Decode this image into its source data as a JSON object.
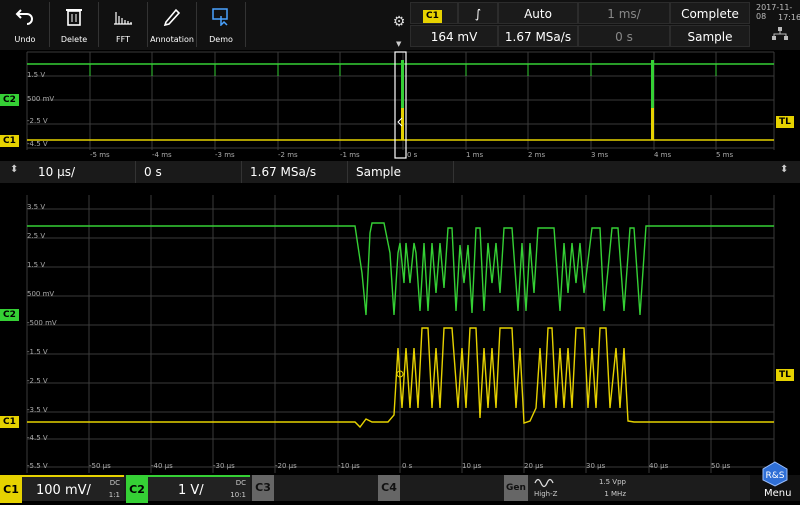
{
  "toolbar": {
    "buttons": [
      {
        "label": "Undo",
        "icon": "undo-icon"
      },
      {
        "label": "Delete",
        "icon": "trash-icon"
      },
      {
        "label": "FFT",
        "icon": "fft-icon"
      },
      {
        "label": "Annotation",
        "icon": "pen-icon"
      },
      {
        "label": "Demo",
        "icon": "demo-icon"
      }
    ],
    "trigger_source": "C1",
    "trigger_slope": "∫",
    "trigger_mode": "Auto",
    "timebase_top": "1 ms/",
    "acq_status": "Complete",
    "trigger_level": "164 mV",
    "sample_rate_top": "1.67 MSa/s",
    "position_top": "0 s",
    "acq_mode_top": "Sample",
    "date": "2017-11-08",
    "time": "17:16"
  },
  "overview": {
    "ylabels": [
      "1.5 V",
      "500 mV",
      "-2.5 V",
      "-4.5 V"
    ],
    "xlabels": [
      "-5 ms",
      "-4 ms",
      "-3 ms",
      "-2 ms",
      "-1 ms",
      "0 s",
      "1 ms",
      "2 ms",
      "3 ms",
      "4 ms",
      "5 ms"
    ],
    "markers": {
      "c2": "C2",
      "c1": "C1",
      "tl": "TL"
    }
  },
  "zoom_bar": {
    "timebase": "10 µs/",
    "position": "0 s",
    "sample_rate": "1.67 MSa/s",
    "acq_mode": "Sample"
  },
  "main": {
    "ylabels": [
      "3.5 V",
      "2.5 V",
      "1.5 V",
      "500 mV",
      "-500 mV",
      "-1.5 V",
      "-2.5 V",
      "-3.5 V",
      "-4.5 V",
      "-5.5 V"
    ],
    "xlabels": [
      "-50 µs",
      "-40 µs",
      "-30 µs",
      "-20 µs",
      "-10 µs",
      "0 s",
      "10 µs",
      "20 µs",
      "30 µs",
      "40 µs",
      "50 µs"
    ],
    "markers": {
      "c2": "C2",
      "c1": "C1",
      "tl": "TL"
    }
  },
  "channels": {
    "c1": {
      "tag": "C1",
      "scale": "100 mV/",
      "coupling": "DC",
      "probe": "1:1"
    },
    "c2": {
      "tag": "C2",
      "scale": "1 V/",
      "coupling": "DC",
      "probe": "10:1"
    },
    "c3": {
      "tag": "C3"
    },
    "c4": {
      "tag": "C4"
    },
    "gen": {
      "label": "Gen",
      "mode": "High-Z",
      "amplitude": "1.5 Vpp",
      "frequency": "1 MHz"
    },
    "menu": "Menu"
  },
  "colors": {
    "c1": "#e6d200",
    "c2": "#35d035",
    "grid": "#3a3a3a",
    "bg": "#000000"
  }
}
